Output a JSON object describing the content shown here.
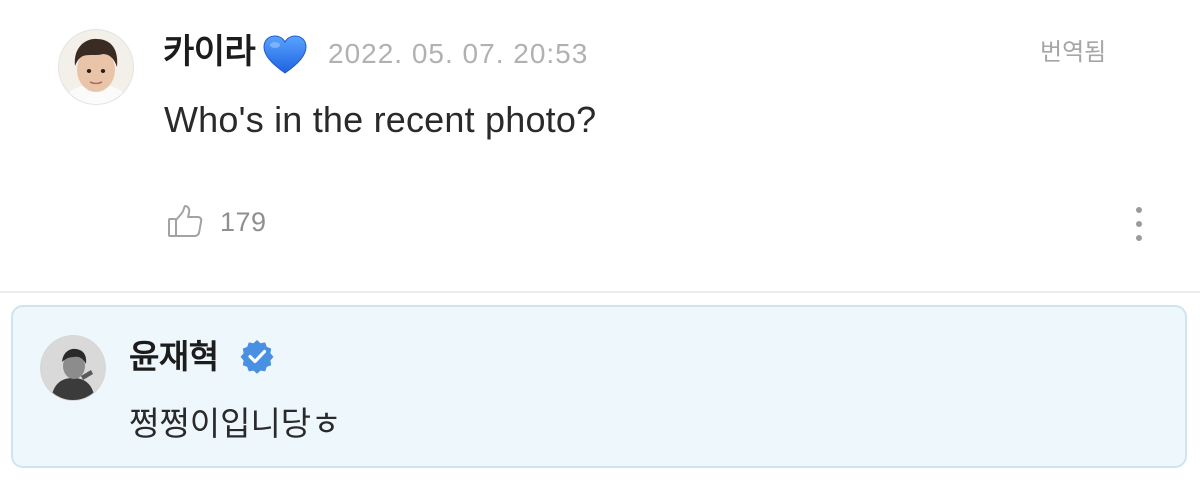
{
  "comment": {
    "author": "카이라",
    "author_emoji": "blue-heart-icon",
    "timestamp": "2022. 05. 07. 20:53",
    "translated_label": "번역됨",
    "text": "Who's in the recent photo?",
    "like_icon": "thumbs-up-icon",
    "like_count": "179",
    "more_icon": "more-vertical-icon"
  },
  "reply": {
    "author": "윤재혁",
    "badge_icon": "verified-badge-icon",
    "text": "쩡쩡이입니당ㅎ"
  },
  "colors": {
    "heart": "#3b82f6",
    "verified": "#4a90e2",
    "reply_background": "#eef8fc",
    "reply_border": "#cfe5ee",
    "muted_text": "#b1b1b1"
  }
}
